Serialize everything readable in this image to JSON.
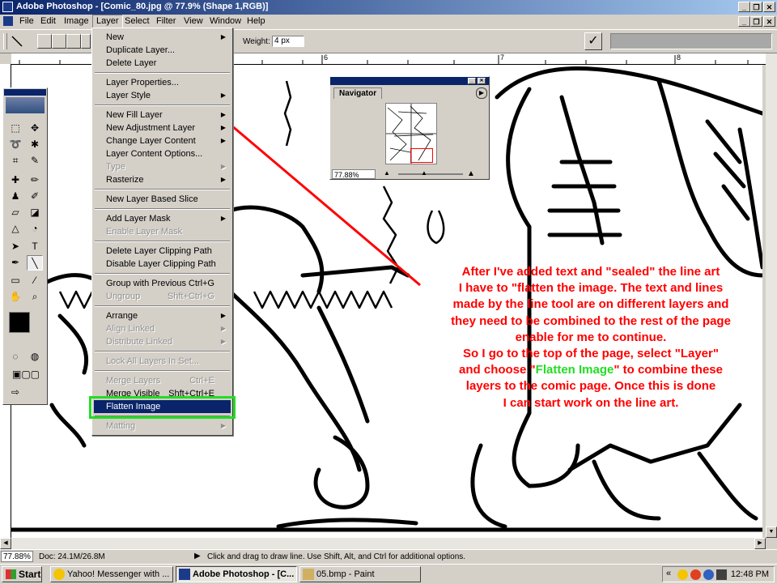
{
  "window": {
    "title": "Adobe Photoshop - [Comic_80.jpg @ 77.9% (Shape 1,RGB)]"
  },
  "menubar": {
    "items": [
      "File",
      "Edit",
      "Image",
      "Layer",
      "Select",
      "Filter",
      "View",
      "Window",
      "Help"
    ]
  },
  "options": {
    "weight_label": "Weight:",
    "weight_value": "4 px"
  },
  "ruler": {
    "marks": [
      "6",
      "7",
      "8"
    ]
  },
  "navigator": {
    "tab_label": "Navigator",
    "zoom": "77.88%"
  },
  "layer_menu": {
    "items": [
      {
        "label": "New",
        "arrow": true
      },
      {
        "label": "Duplicate Layer..."
      },
      {
        "label": "Delete Layer"
      },
      {
        "sep": true
      },
      {
        "label": "Layer Properties..."
      },
      {
        "label": "Layer Style",
        "arrow": true
      },
      {
        "sep": true
      },
      {
        "label": "New Fill Layer",
        "arrow": true
      },
      {
        "label": "New Adjustment Layer",
        "arrow": true
      },
      {
        "label": "Change Layer Content",
        "arrow": true
      },
      {
        "label": "Layer Content Options..."
      },
      {
        "label": "Type",
        "arrow": true,
        "disabled": true
      },
      {
        "label": "Rasterize",
        "arrow": true
      },
      {
        "sep": true
      },
      {
        "label": "New Layer Based Slice"
      },
      {
        "sep": true
      },
      {
        "label": "Add Layer Mask",
        "arrow": true
      },
      {
        "label": "Enable Layer Mask",
        "disabled": true
      },
      {
        "sep": true
      },
      {
        "label": "Delete Layer Clipping Path"
      },
      {
        "label": "Disable Layer Clipping Path"
      },
      {
        "sep": true
      },
      {
        "label": "Group with Previous",
        "shortcut": "Ctrl+G"
      },
      {
        "label": "Ungroup",
        "shortcut": "Shft+Ctrl+G",
        "disabled": true
      },
      {
        "sep": true
      },
      {
        "label": "Arrange",
        "arrow": true
      },
      {
        "label": "Align Linked",
        "arrow": true,
        "disabled": true
      },
      {
        "label": "Distribute Linked",
        "arrow": true,
        "disabled": true
      },
      {
        "sep": true
      },
      {
        "label": "Lock All Layers In Set...",
        "disabled": true
      },
      {
        "sep": true
      },
      {
        "label": "Merge Layers",
        "shortcut": "Ctrl+E",
        "disabled": true
      },
      {
        "label": "Merge Visible",
        "shortcut": "Shft+Ctrl+E"
      },
      {
        "label": "Flatten Image",
        "highlighted": true
      },
      {
        "sep": true
      },
      {
        "label": "Matting",
        "arrow": true,
        "disabled": true
      }
    ]
  },
  "annotation": {
    "line1": "After I've added text and \"sealed\" the line art",
    "line2": "I have to \"flatten the image. The text and lines",
    "line3": "made by the line tool are on different layers and",
    "line4": "they need to be combined to the rest of the page",
    "line5": "enable for me to continue.",
    "line6": "So I go to the top of the page, select \"Layer\"",
    "line7_a": "and choose \"",
    "line7_green": "Flatten Image",
    "line7_b": "\" to combine these",
    "line8": "layers to the comic page. Once this is done",
    "line9": "I can start work on the line art.",
    "red": "#ff0000",
    "green": "#22dd22"
  },
  "status": {
    "zoom": "77.88%",
    "doc": "Doc: 24.1M/26.8M",
    "hint": "Click and drag to draw line. Use Shift, Alt, and Ctrl for additional options."
  },
  "taskbar": {
    "start": "Start",
    "tasks": [
      "Yahoo! Messenger with ...",
      "Adobe Photoshop - [C...",
      "05.bmp - Paint"
    ],
    "clock": "12:48 PM"
  }
}
